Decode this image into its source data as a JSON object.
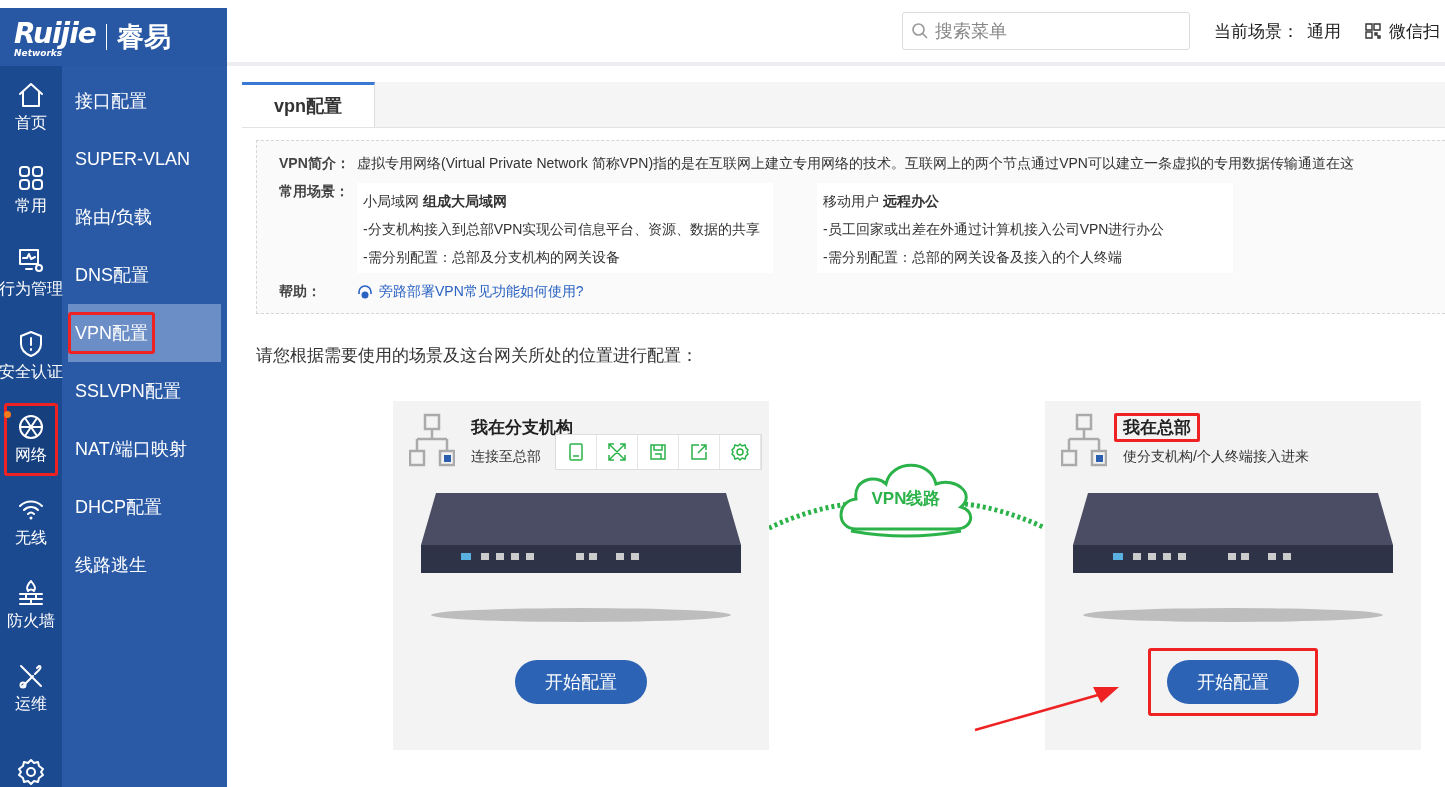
{
  "logo": {
    "brand": "Ruijie",
    "sub": "Networks",
    "name": "睿易"
  },
  "rail": [
    {
      "label": "首页",
      "selected": false,
      "annotated": false,
      "dot": false
    },
    {
      "label": "常用",
      "selected": false,
      "annotated": false,
      "dot": false
    },
    {
      "label": "行为管理",
      "selected": false,
      "annotated": false,
      "dot": false
    },
    {
      "label": "安全认证",
      "selected": false,
      "annotated": false,
      "dot": false
    },
    {
      "label": "网络",
      "selected": true,
      "annotated": true,
      "dot": true
    },
    {
      "label": "无线",
      "selected": false,
      "annotated": false,
      "dot": false
    },
    {
      "label": "防火墙",
      "selected": false,
      "annotated": false,
      "dot": false
    },
    {
      "label": "运维",
      "selected": false,
      "annotated": false,
      "dot": false
    },
    {
      "selected": false,
      "annotated": false,
      "dot": false
    }
  ],
  "submenu": [
    {
      "label": "接口配置",
      "selected": false,
      "annotated": false
    },
    {
      "label": "SUPER-VLAN",
      "selected": false,
      "annotated": false
    },
    {
      "label": "路由/负载",
      "selected": false,
      "annotated": false
    },
    {
      "label": "DNS配置",
      "selected": false,
      "annotated": false
    },
    {
      "label": "VPN配置",
      "selected": true,
      "annotated": true
    },
    {
      "label": "SSLVPN配置",
      "selected": false,
      "annotated": false
    },
    {
      "label": "NAT/端口映射",
      "selected": false,
      "annotated": false
    },
    {
      "label": "DHCP配置",
      "selected": false,
      "annotated": false
    },
    {
      "label": "线路逃生",
      "selected": false,
      "annotated": false
    }
  ],
  "topbar": {
    "search": {
      "placeholder": "搜索菜单"
    },
    "scene_label": "当前场景：",
    "scene_value": "通用",
    "wechat": "微信扫"
  },
  "tabs": [
    {
      "label": "vpn配置",
      "selected": true
    }
  ],
  "intro": {
    "label": "VPN简介：",
    "text": "虚拟专用网络(Virtual Private Network 简称VPN)指的是在互联网上建立专用网络的技术。互联网上的两个节点通过VPN可以建立一条虚拟的专用数据传输通道在这",
    "scenarios_label": "常用场景：",
    "scenarios": [
      {
        "title": "小局域网 **组成大局域网**",
        "lines": [
          "-分支机构接入到总部VPN实现公司信息平台、资源、数据的共享",
          "-需分别配置：总部及分支机构的网关设备"
        ]
      },
      {
        "title": "移动用户 **远程办公**",
        "lines": [
          "-员工回家或出差在外通过计算机接入公司VPN进行办公",
          "-需分别配置：总部的网关设备及接入的个人终端"
        ]
      }
    ],
    "help_label": "帮助：",
    "help_link": "旁路部署VPN常见功能如何使用?"
  },
  "instruction": "请您根据需要使用的场景及这台网关所处的位置进行配置：",
  "diagram": {
    "link_label": "VPN线路",
    "pointer_arrow": true,
    "cards": [
      {
        "title": "我在分支机构",
        "subtitle": "连接至总部",
        "button": "开始配置",
        "toolbar": true,
        "title_annotated": false,
        "button_annotated": false
      },
      {
        "title": "我在总部",
        "subtitle": "使分支机构/个人终端接入进来",
        "button": "开始配置",
        "toolbar": false,
        "title_annotated": true,
        "button_annotated": true
      }
    ]
  }
}
